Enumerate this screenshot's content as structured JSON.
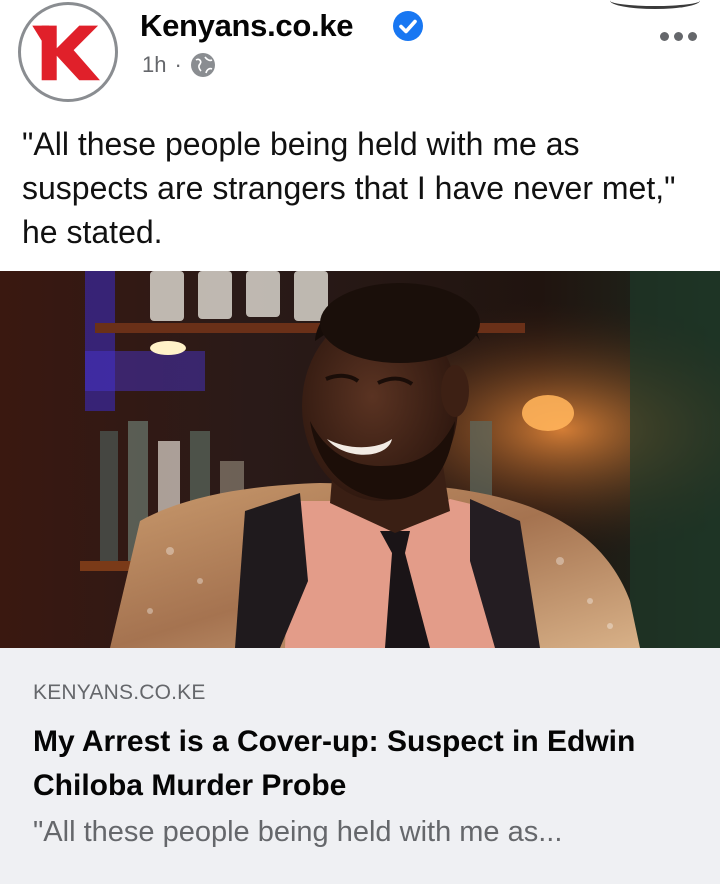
{
  "post": {
    "page_name": "Kenyans.co.ke",
    "time": "1h",
    "separator": "·",
    "privacy_icon": "globe-icon",
    "verified_icon": "verified-badge-icon",
    "more_icon": "more-options-icon",
    "caption": "\"All these people being held with me as suspects are strangers that I have never met,\" he stated."
  },
  "logo": {
    "letter": "K",
    "brand_red": "#e0202a"
  },
  "link_card": {
    "domain": "KENYANS.CO.KE",
    "headline": "My Arrest is a Cover-up: Suspect in Edwin Chiloba Murder Probe",
    "description": "\"All these people being held with me as..."
  },
  "colors": {
    "verified_blue": "#1877f2",
    "card_bg": "#eff0f3",
    "secondary_text": "#65676b"
  }
}
